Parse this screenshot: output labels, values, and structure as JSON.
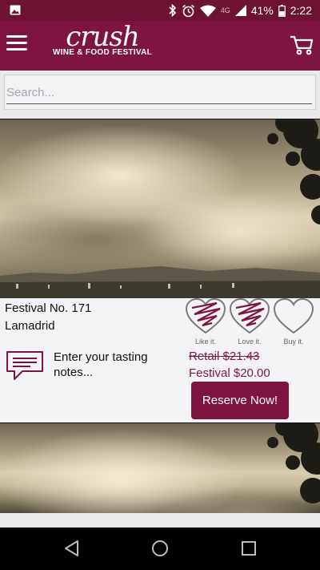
{
  "status_bar": {
    "battery": "41%",
    "time": "2:22",
    "network": "4G"
  },
  "header": {
    "logo_script": "crush",
    "logo_sub": "WINE & FOOD FESTIVAL"
  },
  "search": {
    "placeholder": "Search..."
  },
  "listings": [
    {
      "title": "Festival No. 171",
      "winery": "Lamadrid",
      "ratings": [
        "Like it.",
        "Love it.",
        "Buy it."
      ],
      "notes_label": "Enter your tasting notes...",
      "retail_price": "Retail $21.43",
      "festival_price": "Festival $20.00",
      "reserve_label": "Reserve Now!"
    }
  ],
  "colors": {
    "brand": "#7d1540",
    "status_bar": "#6e1233",
    "background": "#e9e9ec"
  },
  "icons": [
    "image-icon",
    "bluetooth-icon",
    "alarm-icon",
    "wifi-icon",
    "signal-icon",
    "battery-icon",
    "menu-icon",
    "cart-icon",
    "heart-icon",
    "notes-icon",
    "back-icon",
    "home-icon",
    "recents-icon"
  ]
}
